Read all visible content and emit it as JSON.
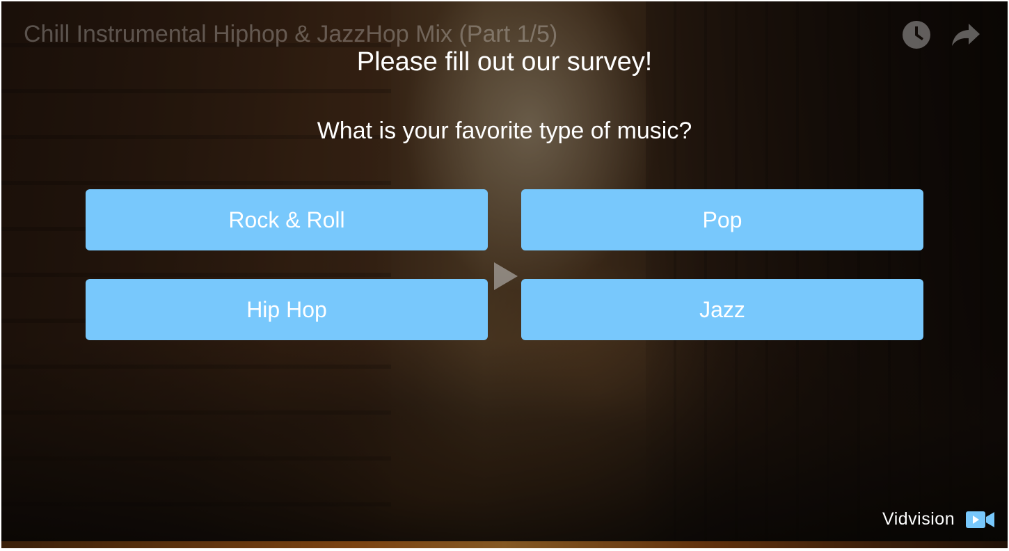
{
  "video": {
    "title": "Chill Instrumental Hiphop & JazzHop Mix (Part 1/5)",
    "icons": {
      "watch_later": "clock-icon",
      "share": "share-arrow-icon",
      "play": "play-icon"
    }
  },
  "survey": {
    "title": "Please fill out our survey!",
    "question": "What is your favorite type of music?",
    "options": [
      "Rock & Roll",
      "Pop",
      "Hip Hop",
      "Jazz"
    ],
    "button_color": "#78c8fc"
  },
  "branding": {
    "name": "Vidvision",
    "icon": "video-camera-icon",
    "icon_color": "#78c8fc"
  }
}
